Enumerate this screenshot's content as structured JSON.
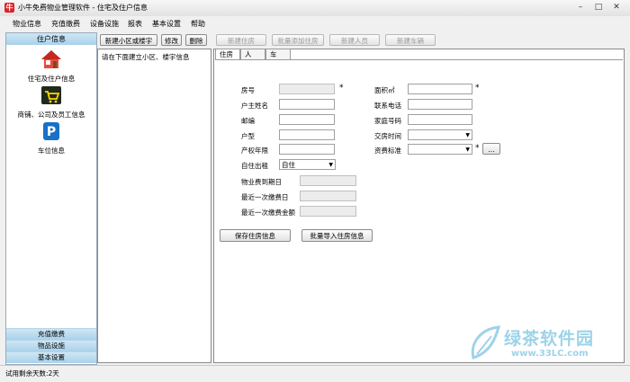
{
  "window": {
    "title": "小牛免费物业管理软件 - 住宅及住户信息",
    "app_icon_char": "牛",
    "minimize_glyph": "–",
    "maximize_glyph": "□",
    "close_glyph": "✕"
  },
  "menu": [
    "物业信息",
    "充值缴费",
    "设备设施",
    "报表",
    "基本设置",
    "帮助"
  ],
  "sidebar": {
    "header": "住户信息",
    "items": [
      {
        "label": "住宅及住户信息",
        "icon": "house-icon"
      },
      {
        "label": "商铺、公司及员工信息",
        "icon": "shop-cart-icon"
      },
      {
        "label": "车位信息",
        "icon": "parking-icon",
        "icon_char": "P"
      }
    ],
    "footer": [
      "充值缴费",
      "物品设施",
      "基本设置"
    ]
  },
  "toolbar": {
    "new_community": "新建小区或楼宇",
    "modify": "修改",
    "delete": "删除",
    "new_house": "新建住房",
    "batch_add_house": "批量添加住房",
    "new_person": "新建人员",
    "new_vehicle": "新建车辆"
  },
  "tree": {
    "hint": "请在下面建立小区、楼宇信息"
  },
  "tabs": [
    "住房",
    "人",
    "车"
  ],
  "form": {
    "room_no": "房号",
    "area": "面积㎡",
    "owner_name": "户主姓名",
    "contact_phone": "联系电话",
    "postcode": "邮编",
    "home_phone": "家庭号码",
    "house_type": "户型",
    "handover_time": "交房时间",
    "property_years": "产权年限",
    "fee_standard": "资费标准",
    "self_or_rent": "自住出租",
    "self_or_rent_value": "自住",
    "property_fee_due": "物业费到期日",
    "last_payment_date": "最近一次缴费日",
    "last_payment_amount": "最近一次缴费金额",
    "required_mark": "*",
    "browse_label": "...",
    "save_button": "保存住房信息",
    "import_button": "批量导入住房信息"
  },
  "status": {
    "text": "试用剩余天数:2天"
  },
  "watermark": {
    "text": "绿茶软件园",
    "url": "www.33LC.com"
  }
}
